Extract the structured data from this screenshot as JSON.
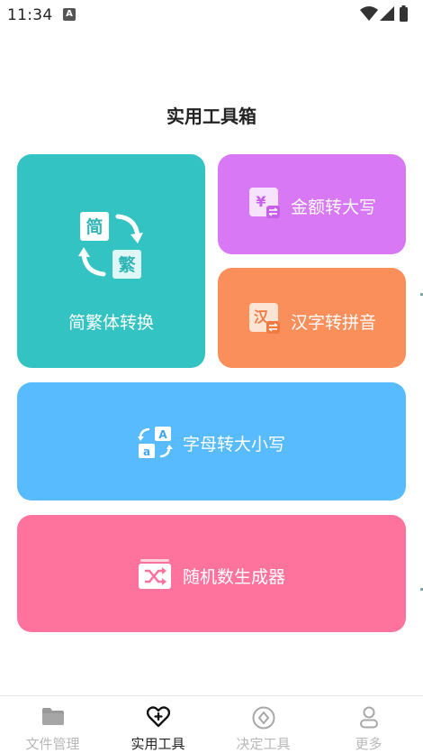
{
  "status_bar": {
    "time": "11:34",
    "notification_icon": "a-icon"
  },
  "page": {
    "title": "实用工具箱"
  },
  "tools": {
    "convert": {
      "label": "简繁体转换",
      "icon_simplified": "简",
      "icon_traditional": "繁",
      "color": "#33c3c3"
    },
    "money": {
      "label": "金额转大写",
      "icon_glyph": "¥",
      "color": "#d978f5"
    },
    "pinyin": {
      "label": "汉字转拼音",
      "icon_glyph": "汉",
      "color": "#fb8f5c"
    },
    "case": {
      "label": "字母转大小写",
      "icon_upper": "A",
      "icon_lower": "a",
      "color": "#58bbfe"
    },
    "random": {
      "label": "随机数生成器",
      "color": "#fd739d"
    }
  },
  "tab_bar": {
    "tabs": [
      {
        "label": "文件管理",
        "icon": "folder-icon",
        "active": false
      },
      {
        "label": "实用工具",
        "icon": "heart-plus-icon",
        "active": true
      },
      {
        "label": "决定工具",
        "icon": "compass-icon",
        "active": false
      },
      {
        "label": "更多",
        "icon": "person-icon",
        "active": false
      }
    ]
  }
}
